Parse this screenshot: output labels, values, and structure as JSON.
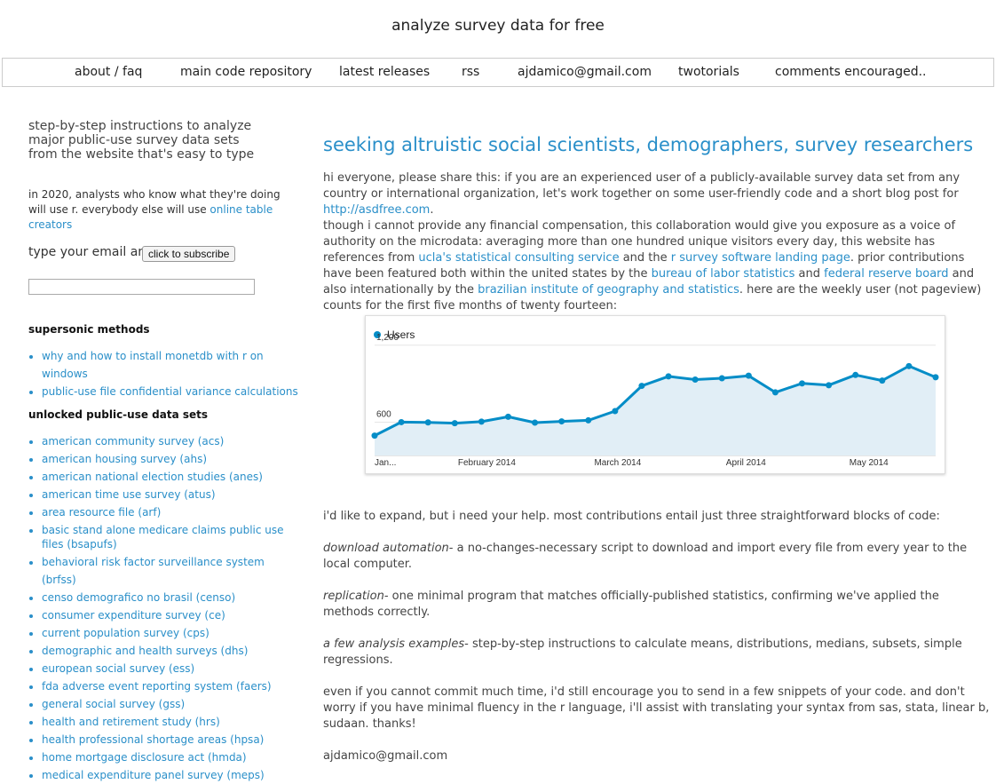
{
  "site": {
    "title": "analyze survey data for free"
  },
  "nav": [
    {
      "label": "about / faq"
    },
    {
      "label": "main code repository"
    },
    {
      "label": "latest releases"
    },
    {
      "label": "rss"
    },
    {
      "label": "ajdamico@gmail.com"
    },
    {
      "label": "twotorials"
    },
    {
      "label": "comments encouraged.."
    }
  ],
  "sidebar": {
    "tagline_lines": [
      "step-by-step instructions to analyze",
      "major public-use survey data sets",
      "from the website that's easy to type"
    ],
    "r_note_text": "in 2020, analysts who know what they're doing will use r. everybody else will use ",
    "r_note_link": "online table creators",
    "subscribe_label": "type your email and",
    "subscribe_button": "click to subscribe",
    "email_value": "",
    "supersonic_heading": "supersonic methods",
    "supersonic_items": [
      "why and how to install monetdb with r on windows",
      "public-use file confidential variance calculations"
    ],
    "unlocked_heading": "unlocked public-use data sets",
    "unlocked_items": [
      "american community survey (acs)",
      "american housing survey (ahs)",
      "american national election studies (anes)",
      "american time use survey (atus)",
      "area resource file (arf)",
      "basic stand alone medicare claims public use files (bsapufs)",
      "behavioral risk factor surveillance system (brfss)",
      "censo demografico no brasil (censo)",
      "consumer expenditure survey (ce)",
      "current population survey (cps)",
      "demographic and health surveys (dhs)",
      "european social survey (ess)",
      "fda adverse event reporting system (faers)",
      "general social survey (gss)",
      "health and retirement study (hrs)",
      "health professional shortage areas (hpsa)",
      "home mortgage disclosure act (hmda)",
      "medical expenditure panel survey (meps)"
    ]
  },
  "post": {
    "title": "seeking altruistic social scientists, demographers, survey researchers",
    "p1_text": "hi everyone, please share this:  if you are an experienced user of a publicly-available survey data set from any country or international organization, let's work together on some user-friendly code and a short blog post for ",
    "p1_link": "http://asdfree.com",
    "p1_end": ".",
    "p2_a": "though i cannot provide any financial compensation, this collaboration would give you exposure as a voice of authority on the microdata: averaging more than one hundred unique visitors every day, this website has references from ",
    "p2_link1": "ucla's statistical consulting service",
    "p2_b": " and the ",
    "p2_link2": "r survey software landing page",
    "p2_c": ".  prior contributions have been featured both within the united states by the ",
    "p2_link3": "bureau of labor statistics",
    "p2_d": " and ",
    "p2_link4": "federal reserve board",
    "p2_e": " and also internationally by the ",
    "p2_link5": "brazilian institute of geography and statistics",
    "p2_f": ".  here are the weekly user (not pageview) counts for the first five months of twenty fourteen:",
    "p3": "i'd like to expand, but i need your help.  most contributions entail just three straightforward blocks of code:",
    "b1_em": "download automation",
    "b1_text": "- a no-changes-necessary script to download and import every file from every year to the local computer.",
    "b2_em": "replication",
    "b2_text": "- one minimal program that matches officially-published statistics, confirming we've applied the methods correctly.",
    "b3_em": "a few analysis examples",
    "b3_text": "- step-by-step instructions to calculate means, distributions, medians, subsets, simple regressions.",
    "p4": "even if you cannot commit much time, i'd still encourage you to send in a few snippets of your code.  and don't worry if you have minimal fluency in the r language, i'll assist with translating your syntax from sas, stata, linear b, sudaan.  thanks!",
    "contact": "ajdamico@gmail.com"
  },
  "chart_data": {
    "type": "area",
    "legend": "Users",
    "legend_placement": "top-left",
    "y_ticks": [
      "1,200",
      "600"
    ],
    "y_tick_values": [
      1200,
      600
    ],
    "x_tick_labels": [
      "Jan...",
      "February 2014",
      "March 2014",
      "April 2014",
      "May 2014"
    ],
    "ylim": [
      340,
      1330
    ],
    "grid": true,
    "colors": {
      "line": "#058dc7",
      "fill": "#e1eef6",
      "dot": "#058dc7"
    },
    "series": [
      {
        "name": "Users",
        "values": [
          495,
          600,
          598,
          592,
          604,
          642,
          596,
          606,
          614,
          686,
          883,
          957,
          932,
          942,
          962,
          832,
          902,
          888,
          968,
          924,
          1037,
          950
        ]
      }
    ]
  }
}
